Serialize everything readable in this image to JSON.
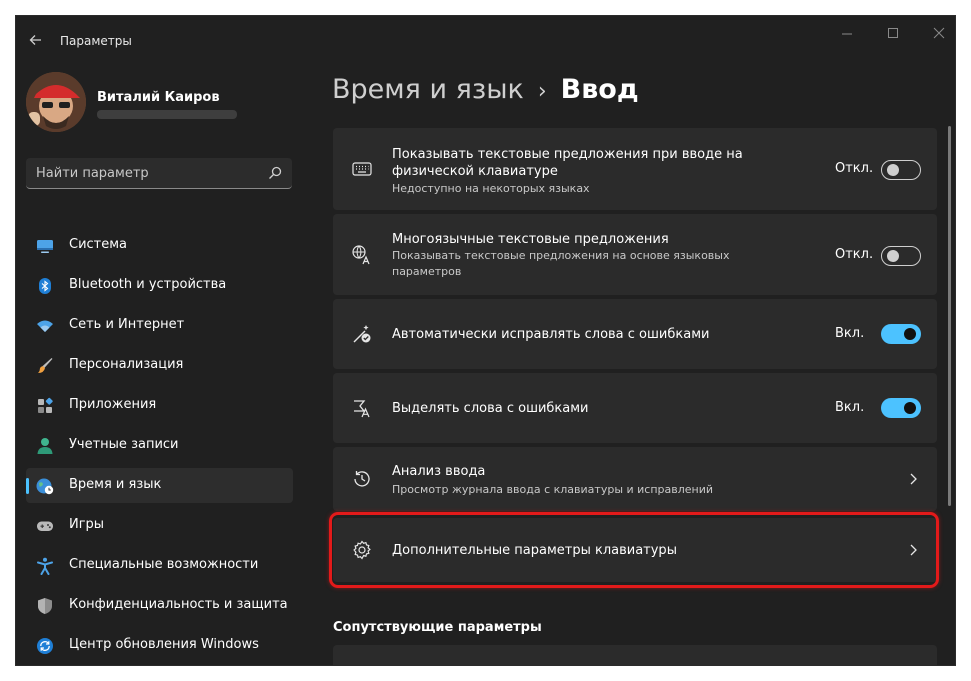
{
  "window": {
    "title": "Параметры"
  },
  "user": {
    "name": "Виталий Каиров"
  },
  "search": {
    "placeholder": "Найти параметр"
  },
  "colors": {
    "accent": "#4cc2ff",
    "highlight": "#e31a1a",
    "window_bg": "#202020",
    "card_bg": "#2b2b2b"
  },
  "sidebar": {
    "items": [
      {
        "label": "Система",
        "icon": "monitor-icon"
      },
      {
        "label": "Bluetooth и устройства",
        "icon": "bluetooth-icon"
      },
      {
        "label": "Сеть и Интернет",
        "icon": "wifi-icon"
      },
      {
        "label": "Персонализация",
        "icon": "brush-icon"
      },
      {
        "label": "Приложения",
        "icon": "apps-icon"
      },
      {
        "label": "Учетные записи",
        "icon": "person-icon"
      },
      {
        "label": "Время и язык",
        "icon": "globe-clock-icon",
        "active": true
      },
      {
        "label": "Игры",
        "icon": "gamepad-icon"
      },
      {
        "label": "Специальные возможности",
        "icon": "accessibility-icon"
      },
      {
        "label": "Конфиденциальность и защита",
        "icon": "shield-icon"
      },
      {
        "label": "Центр обновления Windows",
        "icon": "update-icon"
      }
    ]
  },
  "breadcrumb": {
    "parent": "Время и язык",
    "separator": "›",
    "current": "Ввод"
  },
  "settings": [
    {
      "title": "Показывать текстовые предложения при вводе на физической клавиатуре",
      "desc": "Недоступно на некоторых языках",
      "state_label": "Откл.",
      "on": false,
      "icon": "keyboard-icon"
    },
    {
      "title": "Многоязычные текстовые предложения",
      "desc": "Показывать текстовые предложения на основе языковых параметров",
      "state_label": "Откл.",
      "on": false,
      "icon": "language-icon"
    },
    {
      "title": "Автоматически исправлять слова с ошибками",
      "state_label": "Вкл.",
      "on": true,
      "icon": "autocorrect-icon"
    },
    {
      "title": "Выделять слова с ошибками",
      "state_label": "Вкл.",
      "on": true,
      "icon": "spellcheck-icon"
    },
    {
      "title": "Анализ ввода",
      "desc": "Просмотр журнала ввода с клавиатуры и исправлений",
      "icon": "history-icon"
    },
    {
      "title": "Дополнительные параметры клавиатуры",
      "icon": "gear-icon",
      "highlighted": true
    }
  ],
  "related": {
    "title": "Сопутствующие параметры"
  }
}
